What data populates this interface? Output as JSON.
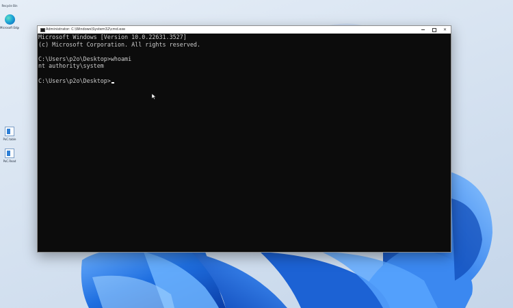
{
  "desktop": {
    "icons": [
      {
        "label": "Recycle Bin",
        "icon": "recycle-bin-icon"
      },
      {
        "label": "Microsoft Edge",
        "icon": "edge-icon"
      },
      {
        "label": "PoC.table",
        "icon": "app-icon"
      },
      {
        "label": "PoC.Read",
        "icon": "app-icon"
      }
    ]
  },
  "window": {
    "title": "Administrator: C:\\Windows\\System32\\cmd.exe",
    "controls": {
      "minimize": "minimize",
      "maximize": "maximize",
      "close": "✕"
    }
  },
  "console": {
    "lines": [
      "Microsoft Windows [Version 10.0.22631.3527]",
      "(c) Microsoft Corporation. All rights reserved.",
      "",
      "C:\\Users\\p2o\\Desktop>whoami",
      "nt authority\\system",
      "",
      "C:\\Users\\p2o\\Desktop>"
    ]
  },
  "colors": {
    "console_bg": "#0c0c0c",
    "console_fg": "#cccccc",
    "wallpaper_bloom": "#1a62d6",
    "titlebar_bg": "#ffffff"
  }
}
